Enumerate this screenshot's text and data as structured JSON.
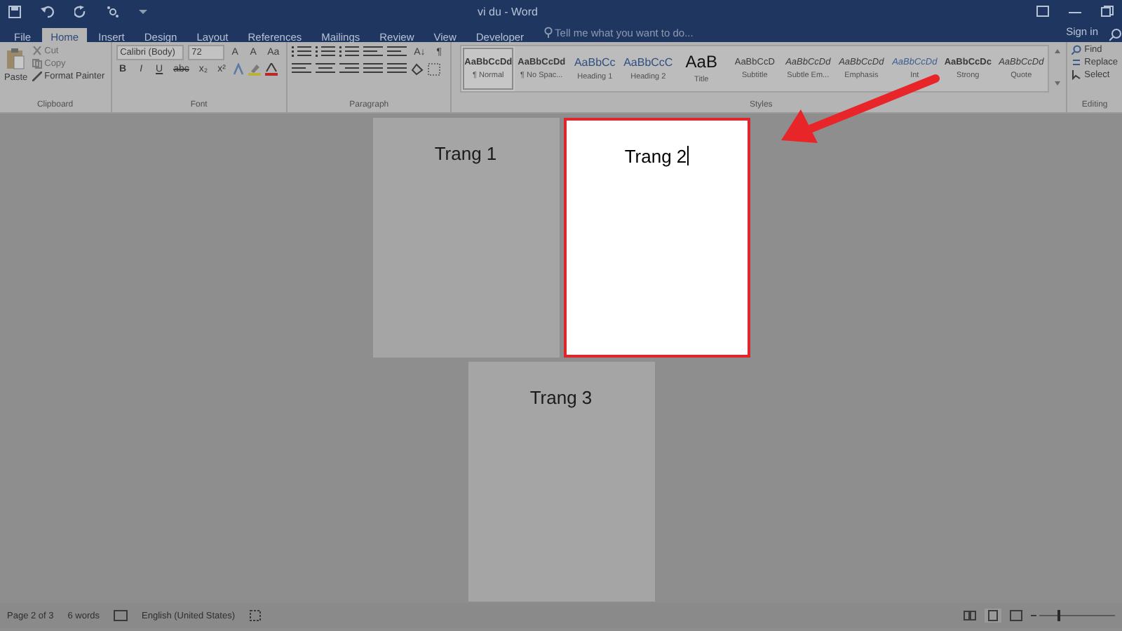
{
  "window": {
    "title": "vi du - Word"
  },
  "tabs": [
    {
      "label": "File",
      "selected": false
    },
    {
      "label": "Home",
      "selected": true
    },
    {
      "label": "Insert",
      "selected": false
    },
    {
      "label": "Design",
      "selected": false
    },
    {
      "label": "Layout",
      "selected": false
    },
    {
      "label": "References",
      "selected": false
    },
    {
      "label": "Mailings",
      "selected": false
    },
    {
      "label": "Review",
      "selected": false
    },
    {
      "label": "View",
      "selected": false
    },
    {
      "label": "Developer",
      "selected": false
    }
  ],
  "tell_me": {
    "placeholder": "Tell me what you want to do..."
  },
  "sign_in": "Sign in",
  "clipboard": {
    "paste": "Paste",
    "cut": "Cut",
    "copy": "Copy",
    "format_painter": "Format Painter",
    "label": "Clipboard"
  },
  "font": {
    "name": "Calibri (Body)",
    "size": "72",
    "row1": [
      "A",
      "A",
      "Aa"
    ],
    "row2": [
      "B",
      "I",
      "U",
      "abc",
      "x₂",
      "x²"
    ],
    "label": "Font"
  },
  "paragraph": {
    "label": "Paragraph",
    "sort": "A↓",
    "pilcrow": "¶"
  },
  "styles": {
    "label": "Styles",
    "items": [
      {
        "preview": "AaBbCcDd",
        "name": "¶ Normal",
        "kind": "bold",
        "selected": true
      },
      {
        "preview": "AaBbCcDd",
        "name": "¶ No Spac...",
        "kind": "bold",
        "selected": false
      },
      {
        "preview": "AaBbCc",
        "name": "Heading 1",
        "kind": "heading",
        "selected": false
      },
      {
        "preview": "AaBbCcC",
        "name": "Heading 2",
        "kind": "heading",
        "selected": false
      },
      {
        "preview": "AaB",
        "name": "Title",
        "kind": "title",
        "selected": false
      },
      {
        "preview": "AaBbCcD",
        "name": "Subtitle",
        "kind": "plain",
        "selected": false
      },
      {
        "preview": "AaBbCcDd",
        "name": "Subtle Em...",
        "kind": "italic",
        "selected": false
      },
      {
        "preview": "AaBbCcDd",
        "name": "Emphasis",
        "kind": "italic",
        "selected": false
      },
      {
        "preview": "AaBbCcDd",
        "name": "Int",
        "kind": "intense",
        "selected": false
      },
      {
        "preview": "AaBbCcDc",
        "name": "Strong",
        "kind": "bold",
        "selected": false
      },
      {
        "preview": "AaBbCcDd",
        "name": "Quote",
        "kind": "italic",
        "selected": false
      }
    ]
  },
  "editing": {
    "label": "Editing",
    "find": "Find",
    "replace": "Replace",
    "select": "Select"
  },
  "pages": [
    {
      "text": "Trang 1",
      "selected": false
    },
    {
      "text": "Trang 2",
      "selected": true
    },
    {
      "text": "Trang 3",
      "selected": false
    }
  ],
  "status_bar": {
    "page": "Page 2 of 3",
    "words": "6 words",
    "language": "English (United States)"
  }
}
